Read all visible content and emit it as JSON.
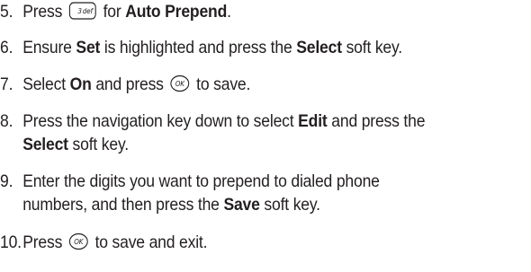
{
  "steps": [
    {
      "num": "5.",
      "t1": "Press",
      "key_label": "3 def",
      "t2": "for",
      "bold1": "Auto Prepend",
      "t3": "."
    },
    {
      "num": "6.",
      "t1": "Ensure",
      "bold1": "Set",
      "t2": "is highlighted and press the",
      "bold2": "Select",
      "t3": "soft key."
    },
    {
      "num": "7.",
      "t1": "Select",
      "bold1": "On",
      "t2": "and press",
      "key_label": "OK",
      "t3": "to save."
    },
    {
      "num": "8.",
      "t1": "Press the navigation key down to select",
      "bold1": "Edit",
      "t2": "and press the",
      "bold2": "Select",
      "t3": "soft key."
    },
    {
      "num": "9.",
      "line1": "Enter the digits you want to prepend to dialed phone",
      "t1": "numbers, and then press the",
      "bold1": "Save",
      "t2": "soft key."
    },
    {
      "num": "10.",
      "t1": "Press",
      "key_label": "OK",
      "t2": "to save and exit."
    }
  ]
}
